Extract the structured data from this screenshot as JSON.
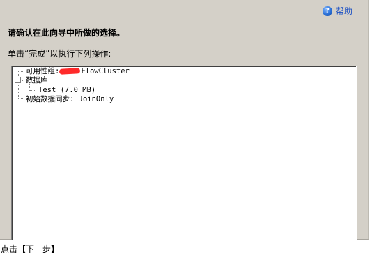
{
  "help": {
    "icon": "help-icon",
    "label": "帮助"
  },
  "heading": "请确认在此向导中所做的选择。",
  "instruction": "单击“完成”以执行下列操作:",
  "tree": {
    "availability_group": {
      "label": "可用性组:",
      "value_visible": "FlowCluster"
    },
    "databases": {
      "label": "数据库",
      "items": [
        {
          "label": "Test (7.0 MB)"
        }
      ]
    },
    "initial_sync": {
      "label": "初始数据同步: JoinOnly"
    }
  },
  "caption": "点击【下一步】"
}
